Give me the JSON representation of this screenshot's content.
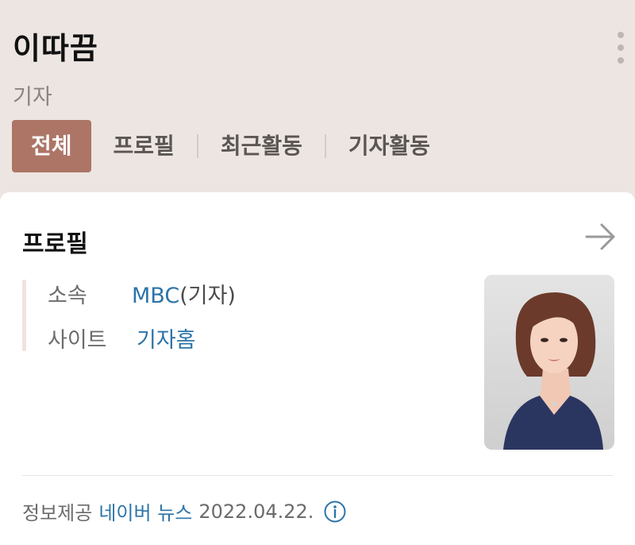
{
  "header": {
    "name": "이따끔",
    "subtitle": "기자",
    "more_icon": "more-vertical-icon"
  },
  "tabs": [
    {
      "label": "전체",
      "active": true
    },
    {
      "label": "프로필",
      "active": false
    },
    {
      "label": "최근활동",
      "active": false
    },
    {
      "label": "기자활동",
      "active": false
    }
  ],
  "profile": {
    "title": "프로필",
    "arrow_icon": "arrow-right-icon",
    "affiliation_label": "소속",
    "affiliation_value": "MBC",
    "affiliation_suffix": "(기자)",
    "site_label": "사이트",
    "site_value": "기자홈",
    "photo_icon": "reporter-photo"
  },
  "footer": {
    "provider_label": "정보제공",
    "provider_value": "네이버 뉴스",
    "date": "2022.04.22.",
    "info_icon": "info-icon"
  },
  "colors": {
    "header_bg": "#ece5e2",
    "tab_active_bg": "#ac7566",
    "link": "#2c74a8"
  }
}
